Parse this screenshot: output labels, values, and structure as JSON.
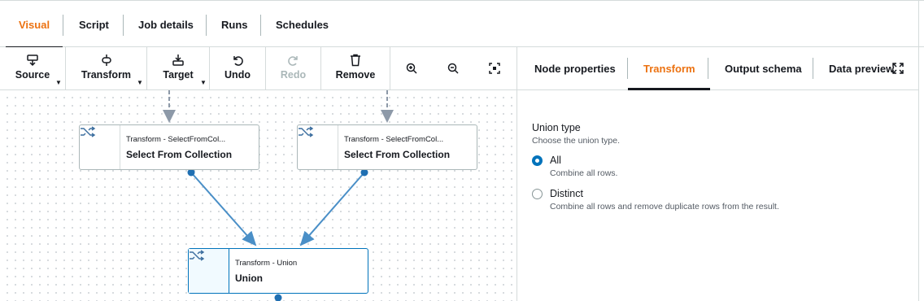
{
  "top_tabs": [
    {
      "label": "Visual",
      "active": true
    },
    {
      "label": "Script",
      "active": false
    },
    {
      "label": "Job details",
      "active": false
    },
    {
      "label": "Runs",
      "active": false
    },
    {
      "label": "Schedules",
      "active": false
    }
  ],
  "toolbar": {
    "source": {
      "label": "Source",
      "icon": "source-icon"
    },
    "transform": {
      "label": "Transform",
      "icon": "transform-icon"
    },
    "target": {
      "label": "Target",
      "icon": "target-icon"
    },
    "undo": {
      "label": "Undo",
      "icon": "undo-icon"
    },
    "redo": {
      "label": "Redo",
      "icon": "redo-icon",
      "disabled": true
    },
    "remove": {
      "label": "Remove",
      "icon": "trash-icon"
    },
    "zoom_in_icon": "zoom-in-icon",
    "zoom_out_icon": "zoom-out-icon",
    "fit_icon": "fit-to-screen-icon"
  },
  "nodes": [
    {
      "subtitle": "Transform - SelectFromCol...",
      "title": "Select From Collection",
      "icon": "shuffle-icon"
    },
    {
      "subtitle": "Transform - SelectFromCol...",
      "title": "Select From Collection",
      "icon": "shuffle-icon"
    },
    {
      "subtitle": "Transform - Union",
      "title": "Union",
      "icon": "shuffle-icon",
      "selected": true
    }
  ],
  "panel": {
    "tabs": [
      {
        "label": "Node properties",
        "active": false
      },
      {
        "label": "Transform",
        "active": true
      },
      {
        "label": "Output schema",
        "active": false
      },
      {
        "label": "Data preview",
        "active": false
      }
    ],
    "union_type": {
      "label": "Union type",
      "description": "Choose the union type.",
      "options": [
        {
          "label": "All",
          "description": "Combine all rows.",
          "checked": true
        },
        {
          "label": "Distinct",
          "description": "Combine all rows and remove duplicate rows from the result.",
          "checked": false
        }
      ]
    }
  },
  "colors": {
    "accent": "#ec7211",
    "link": "#0073bb",
    "edge": "#4a8fc7"
  }
}
